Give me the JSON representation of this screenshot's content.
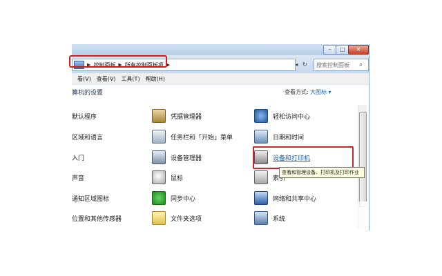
{
  "address_bar": {
    "crumbs": [
      "控制面板",
      "所有控制面板项"
    ],
    "refresh_symbol": "↻",
    "back_symbol": "◂"
  },
  "search": {
    "placeholder": "搜索控制面板"
  },
  "window_buttons": {
    "minimize": "–",
    "maximize": "□",
    "close": "✕"
  },
  "menu": [
    "看(V)",
    "查看(V)",
    "工具(T)",
    "帮助(H)"
  ],
  "view": {
    "title": "算机的设置",
    "label": "查看方式:",
    "value": "大图标 ▾"
  },
  "left_column": [
    "默认程序",
    "区域和语言",
    "入门",
    "声音",
    "通知区域图标",
    "位置和其他传感器"
  ],
  "middle_column": [
    "凭据管理器",
    "任务栏和「开始」菜单",
    "设备管理器",
    "鼠标",
    "同步中心",
    "文件夹选项"
  ],
  "right_column": [
    "轻松访问中心",
    "日期和时间",
    "设备和打印机",
    "索引",
    "网络和共享中心",
    "系统"
  ],
  "tooltip": {
    "title": "设备和打印机",
    "text": "查看和管理设备、打印机及打印作业"
  },
  "icons": {
    "middle": [
      "credential-manager-icon",
      "taskbar-icon",
      "device-manager-icon",
      "mouse-icon",
      "sync-center-icon",
      "folder-options-icon"
    ],
    "right": [
      "ease-of-access-icon",
      "date-time-icon",
      "printer-icon",
      "indexing-icon",
      "network-icon",
      "system-icon"
    ]
  },
  "colors": {
    "highlight_box": "#d51c1c",
    "link_blue": "#1a5ba8"
  }
}
